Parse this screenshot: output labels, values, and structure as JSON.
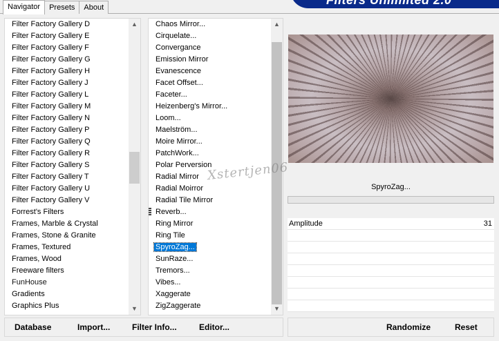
{
  "tabs": [
    {
      "label": "Navigator",
      "active": true
    },
    {
      "label": "Presets",
      "active": false
    },
    {
      "label": "About",
      "active": false
    }
  ],
  "banner": {
    "text": "Filters Unlimited 2.0"
  },
  "categories": [
    "Filter Factory Gallery D",
    "Filter Factory Gallery E",
    "Filter Factory Gallery F",
    "Filter Factory Gallery G",
    "Filter Factory Gallery H",
    "Filter Factory Gallery J",
    "Filter Factory Gallery L",
    "Filter Factory Gallery M",
    "Filter Factory Gallery N",
    "Filter Factory Gallery P",
    "Filter Factory Gallery Q",
    "Filter Factory Gallery R",
    "Filter Factory Gallery S",
    "Filter Factory Gallery T",
    "Filter Factory Gallery U",
    "Filter Factory Gallery V",
    "Forrest's Filters",
    "Frames, Marble & Crystal",
    "Frames, Stone & Granite",
    "Frames, Textured",
    "Frames, Wood",
    "Freeware filters",
    "FunHouse",
    "Gradients",
    "Graphics Plus"
  ],
  "filters": [
    "Chaos Mirror...",
    "Cirquelate...",
    "Convergance",
    "Emission Mirror",
    "Evanescence",
    "Facet Offset...",
    "Faceter...",
    "Heizenberg's Mirror...",
    "Loom...",
    "Maelström...",
    "Moire Mirror...",
    "PatchWork...",
    "Polar Perversion",
    "Radial Mirror",
    "Radial Moirror",
    "Radial Tile Mirror",
    "Reverb...",
    "Ring Mirror",
    "Ring Tile",
    "SpyroZag...",
    "SunRaze...",
    "Tremors...",
    "Vibes...",
    "Xaggerate",
    "ZigZaggerate"
  ],
  "selected_category": "FunHouse",
  "selected_filter": "SpyroZag...",
  "watermark": "Xstertjen06",
  "current_filter": "SpyroZag...",
  "params": [
    {
      "name": "Amplitude",
      "value": "31"
    },
    {
      "name": "",
      "value": ""
    },
    {
      "name": "",
      "value": ""
    },
    {
      "name": "",
      "value": ""
    },
    {
      "name": "",
      "value": ""
    },
    {
      "name": "",
      "value": ""
    },
    {
      "name": "",
      "value": ""
    },
    {
      "name": "",
      "value": ""
    }
  ],
  "buttons": {
    "database": "Database",
    "import": "Import...",
    "filter_info": "Filter Info...",
    "editor": "Editor...",
    "randomize": "Randomize",
    "reset": "Reset"
  },
  "colors": {
    "selection": "#0078d7",
    "banner": "#0a2a8a"
  }
}
